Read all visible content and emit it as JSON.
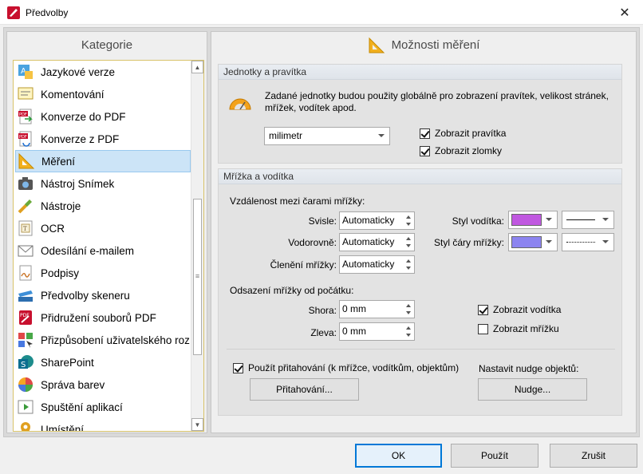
{
  "window": {
    "title": "Předvolby",
    "close_glyph": "✕",
    "icon": "pdf-app-icon"
  },
  "categories": {
    "header": "Kategorie",
    "items": [
      {
        "label": "Jazykové verze",
        "icon": "language-icon"
      },
      {
        "label": "Komentování",
        "icon": "comment-icon"
      },
      {
        "label": "Konverze do PDF",
        "icon": "convert-to-pdf-icon"
      },
      {
        "label": "Konverze z PDF",
        "icon": "convert-from-pdf-icon"
      },
      {
        "label": "Měření",
        "icon": "ruler-triangle-icon",
        "selected": true
      },
      {
        "label": "Nástroj Snímek",
        "icon": "camera-icon"
      },
      {
        "label": "Nástroje",
        "icon": "tools-icon"
      },
      {
        "label": "OCR",
        "icon": "ocr-icon"
      },
      {
        "label": "Odesílání e-mailem",
        "icon": "envelope-icon"
      },
      {
        "label": "Podpisy",
        "icon": "signature-icon"
      },
      {
        "label": "Předvolby skeneru",
        "icon": "scanner-icon"
      },
      {
        "label": "Přidružení souborů PDF",
        "icon": "pdf-file-icon"
      },
      {
        "label": "Přizpůsobení uživatelského roz",
        "icon": "customize-icon"
      },
      {
        "label": "SharePoint",
        "icon": "sharepoint-icon"
      },
      {
        "label": "Správa barev",
        "icon": "color-wheel-icon"
      },
      {
        "label": "Spuštění aplikací",
        "icon": "launch-app-icon"
      },
      {
        "label": "Umístění",
        "icon": "location-icon"
      }
    ]
  },
  "main": {
    "header": "Možnosti měření",
    "units": {
      "title": "Jednotky a pravítka",
      "description_line1": "Zadané jednotky budou použity globálně pro zobrazení pravítek, velikost stránek,",
      "description_line2": "mřížek, vodítek apod.",
      "unit_value": "milimetr",
      "show_rulers": {
        "label": "Zobrazit pravítka",
        "checked": true
      },
      "show_fractions": {
        "label": "Zobrazit zlomky",
        "checked": true
      }
    },
    "grid": {
      "title": "Mřížka a vodítka",
      "spacing_label": "Vzdálenost mezi čarami mřížky:",
      "vertical_label": "Svisle:",
      "vertical_value": "Automaticky",
      "horizontal_label": "Vodorovně:",
      "horizontal_value": "Automaticky",
      "subdivision_label": "Členění mřížky:",
      "subdivision_value": "Automaticky",
      "guide_style_label": "Styl vodítka:",
      "guide_color": "#c058e0",
      "grid_line_style_label": "Styl čáry mřížky:",
      "grid_color": "#8c84f0",
      "offset_label": "Odsazení mřížky od počátku:",
      "top_label": "Shora:",
      "top_value": "0 mm",
      "left_label": "Zleva:",
      "left_value": "0 mm",
      "show_guides": {
        "label": "Zobrazit vodítka",
        "checked": true
      },
      "show_grid": {
        "label": "Zobrazit mřížku",
        "checked": false
      },
      "snap": {
        "label": "Použít přitahování (k mřížce, vodítkům, objektům)",
        "checked": true
      },
      "snap_button": "Přitahování...",
      "nudge_label": "Nastavit nudge objektů:",
      "nudge_button": "Nudge..."
    }
  },
  "footer": {
    "ok": "OK",
    "apply": "Použít",
    "cancel": "Zrušit"
  }
}
